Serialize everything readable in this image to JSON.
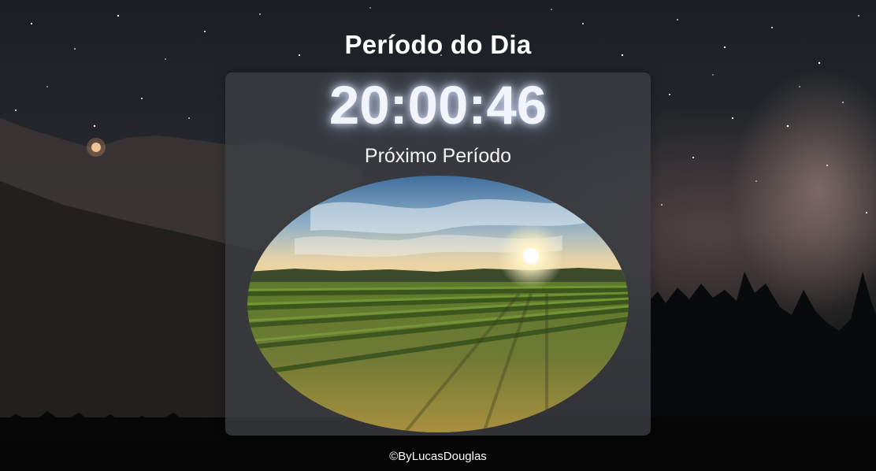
{
  "page": {
    "title": "Período do Dia"
  },
  "clock": {
    "time": "20:00:46"
  },
  "next_period": {
    "label": "Próximo Período",
    "image_icon": "sunset-vineyard-image"
  },
  "footer": {
    "credit": "©ByLucasDouglas"
  },
  "theme": {
    "panel_bg": "#3c3f44",
    "clock_glow": "#dce6ff",
    "text": "#ffffff"
  }
}
